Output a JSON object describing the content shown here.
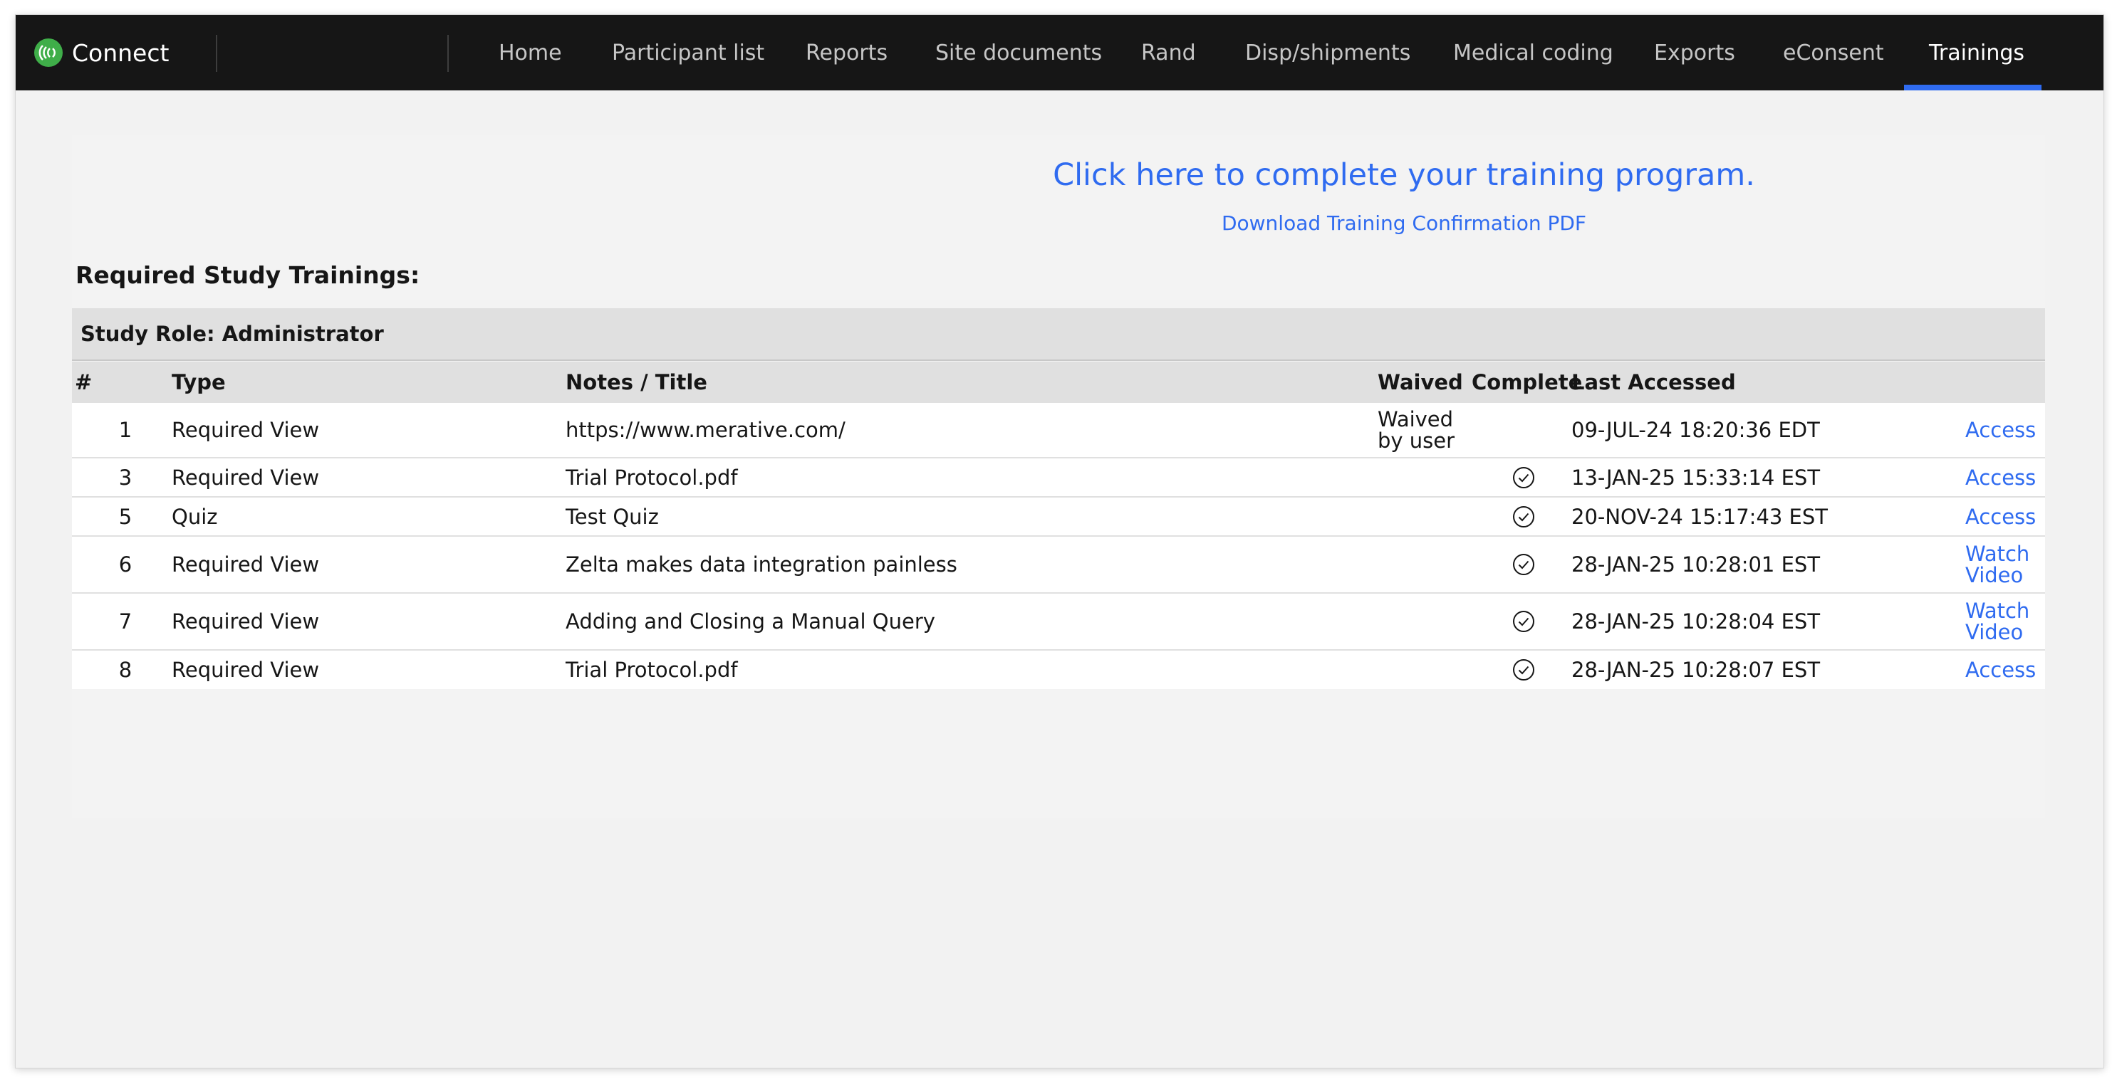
{
  "app": {
    "name": "Connect",
    "logo_icon": "connect-logo-icon",
    "accent_color": "#2f6bf0",
    "nav_background": "#161616"
  },
  "nav": {
    "items": [
      {
        "label": "Home",
        "active": false
      },
      {
        "label": "Participant list",
        "active": false
      },
      {
        "label": "Reports",
        "active": false
      },
      {
        "label": "Site documents",
        "active": false
      },
      {
        "label": "Rand",
        "active": false
      },
      {
        "label": "Disp/shipments",
        "active": false
      },
      {
        "label": "Medical coding",
        "active": false
      },
      {
        "label": "Exports",
        "active": false
      },
      {
        "label": "eConsent",
        "active": false
      },
      {
        "label": "Trainings",
        "active": true
      }
    ]
  },
  "training": {
    "cta_link": "Click here to complete your training program.",
    "download_link": "Download Training Confirmation PDF",
    "section_title": "Required Study Trainings:",
    "role_label": "Study Role: Administrator"
  },
  "table": {
    "headers": {
      "num": "#",
      "type": "Type",
      "title": "Notes / Title",
      "waived": "Waived",
      "complete": "Complete",
      "last_accessed": "Last Accessed"
    },
    "rows": [
      {
        "num": "1",
        "type": "Required View",
        "title": "https://www.merative.com/",
        "waived": "Waived by user",
        "complete": false,
        "last_accessed": "09-JUL-24 18:20:36 EDT",
        "action": "Access"
      },
      {
        "num": "3",
        "type": "Required View",
        "title": "Trial Protocol.pdf",
        "waived": "",
        "complete": true,
        "last_accessed": "13-JAN-25 15:33:14 EST",
        "action": "Access"
      },
      {
        "num": "5",
        "type": "Quiz",
        "title": "Test Quiz",
        "waived": "",
        "complete": true,
        "last_accessed": "20-NOV-24 15:17:43 EST",
        "action": "Access"
      },
      {
        "num": "6",
        "type": "Required View",
        "title": "Zelta makes data integration painless",
        "waived": "",
        "complete": true,
        "last_accessed": "28-JAN-25 10:28:01 EST",
        "action": "Watch Video"
      },
      {
        "num": "7",
        "type": "Required View",
        "title": "Adding and Closing a Manual Query",
        "waived": "",
        "complete": true,
        "last_accessed": "28-JAN-25 10:28:04 EST",
        "action": "Watch Video"
      },
      {
        "num": "8",
        "type": "Required View",
        "title": "Trial Protocol.pdf",
        "waived": "",
        "complete": true,
        "last_accessed": "28-JAN-25 10:28:07 EST",
        "action": "Access"
      }
    ]
  }
}
